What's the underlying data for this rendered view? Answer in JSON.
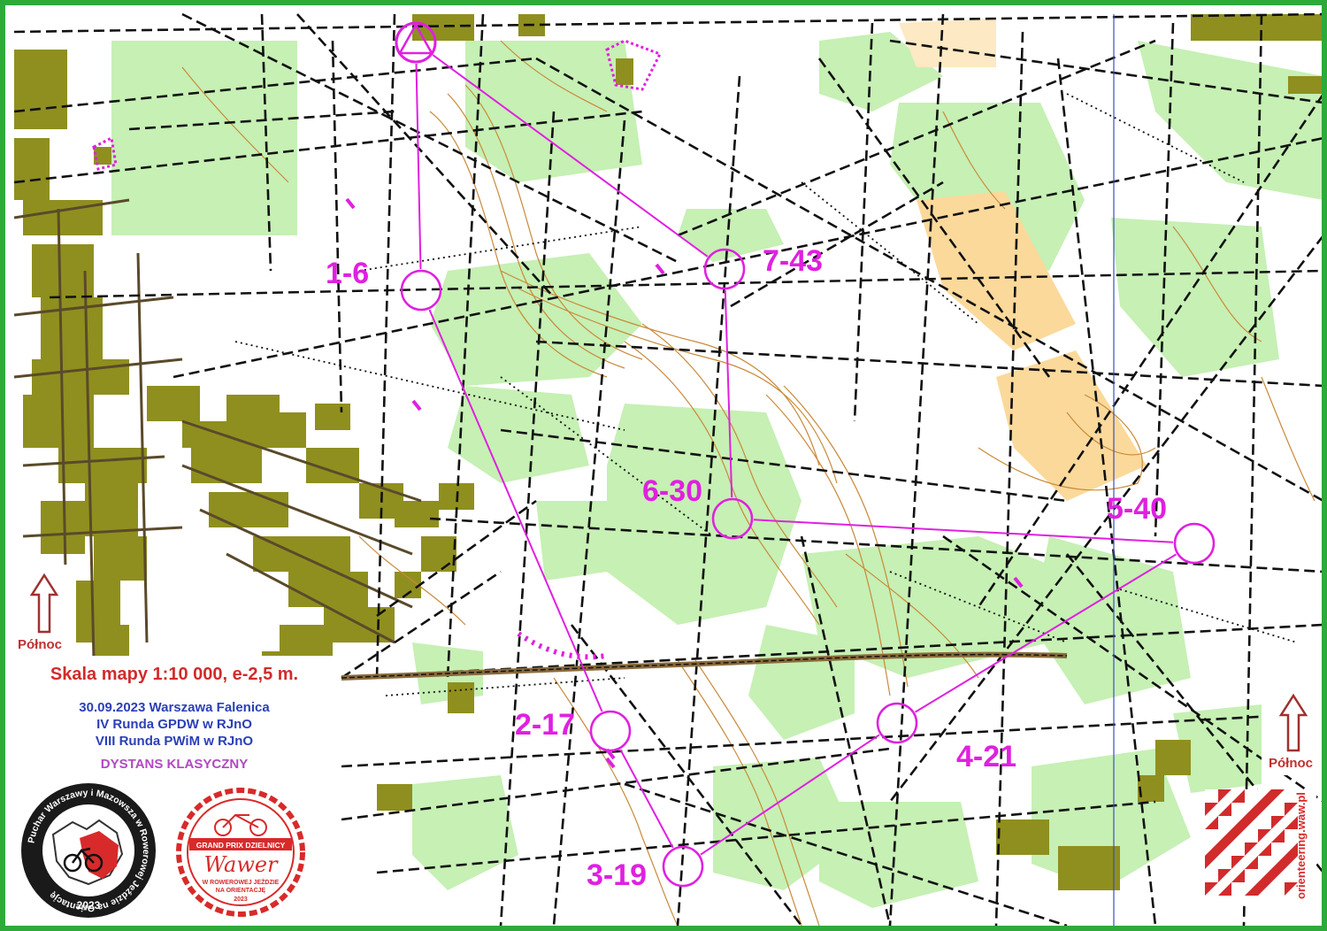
{
  "course": {
    "line_color": "#e020e0",
    "controls": [
      {
        "label": "1-6"
      },
      {
        "label": "2-17"
      },
      {
        "label": "3-19"
      },
      {
        "label": "4-21"
      },
      {
        "label": "5-40"
      },
      {
        "label": "6-30"
      },
      {
        "label": "7-43"
      }
    ]
  },
  "legend": {
    "scale": "Skala mapy 1:10 000, e-2,5 m.",
    "date_place": "30.09.2023 Warszawa Falenica",
    "round1": "IV Runda GPDW w RJnO",
    "round2": "VIII Runda PWiM w RJnO",
    "distance": "DYSTANS KLASYCZNY"
  },
  "north": {
    "left_label": "Północ",
    "right_label": "Północ"
  },
  "logos": {
    "pwim_text": "Puchar Warszawy i Mazowsza w Rowerowej Jeździe na Orientację",
    "pwim_year": "2023",
    "gp_title": "GRAND PRIX DZIELNICY",
    "gp_name": "Wawer",
    "gp_sub1": "W ROWEROWEJ JEŹDZIE",
    "gp_sub2": "NA ORIENTACJĘ",
    "gp_year": "2023",
    "club_url": "orienteering.waw.pl"
  },
  "colors": {
    "frame": "#2eaa3a",
    "forest_green": "#c6f0b4",
    "urban": "#8f8f1f",
    "open_land": "#fbd99b",
    "contour": "#c98a3a",
    "course": "#e020e0",
    "legend_red": "#d22b2b",
    "legend_blue": "#2a3fb8"
  }
}
